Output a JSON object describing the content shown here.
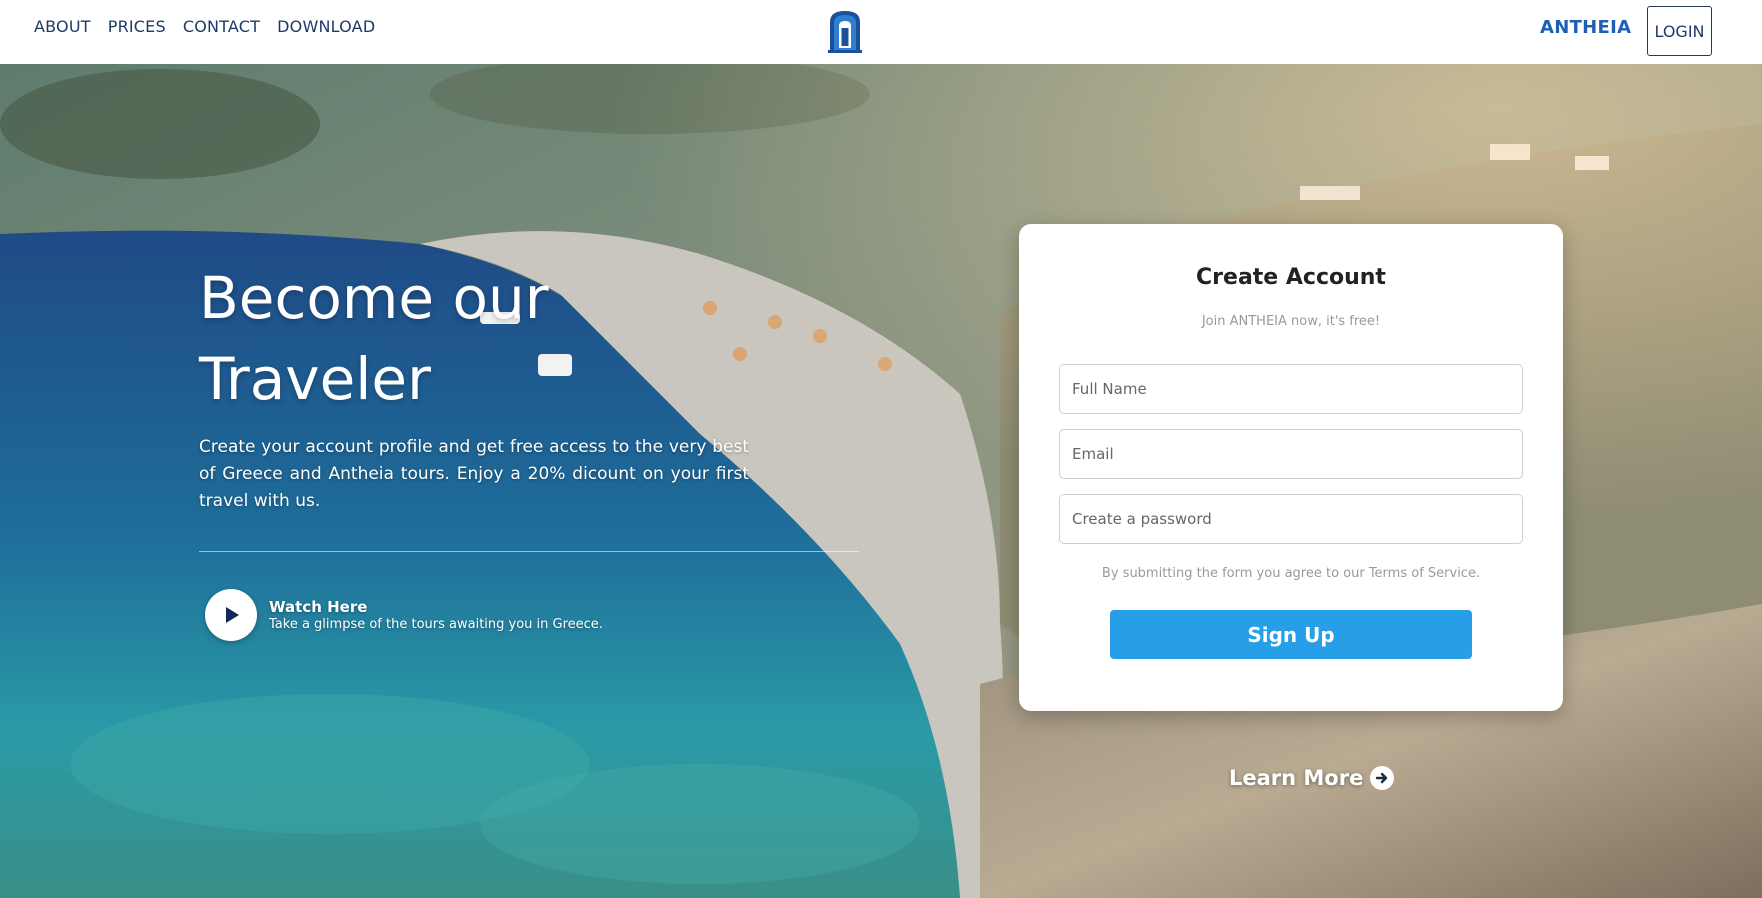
{
  "nav": {
    "items": [
      "ABOUT",
      "PRICES",
      "CONTACT",
      "DOWNLOAD"
    ]
  },
  "header": {
    "brand": "ANTHEIA",
    "login_label": "LOGIN"
  },
  "hero": {
    "headline_line1": "Become our",
    "headline_line2": "Traveler",
    "description": "Create your account profile and get free access to the very best of Greece and Antheia tours. Enjoy a 20% dicount on your first travel with us.",
    "watch_title": "Watch Here",
    "watch_subtitle": "Take a glimpse of the tours awaiting you in Greece.",
    "learn_more": "Learn More"
  },
  "form": {
    "title": "Create Account",
    "subtitle": "Join ANTHEIA now, it's free!",
    "full_name_placeholder": "Full Name",
    "email_placeholder": "Email",
    "password_placeholder": "Create a password",
    "terms": "By submitting the form you agree to our Terms of Service.",
    "submit_label": "Sign Up"
  },
  "colors": {
    "brand": "#1d5fb4",
    "button": "#279fe8",
    "nav_text": "#1f3a66"
  },
  "icons": {
    "logo": "greek-door-logo-icon",
    "play": "play-icon",
    "arrow": "arrow-right-circle-icon"
  }
}
